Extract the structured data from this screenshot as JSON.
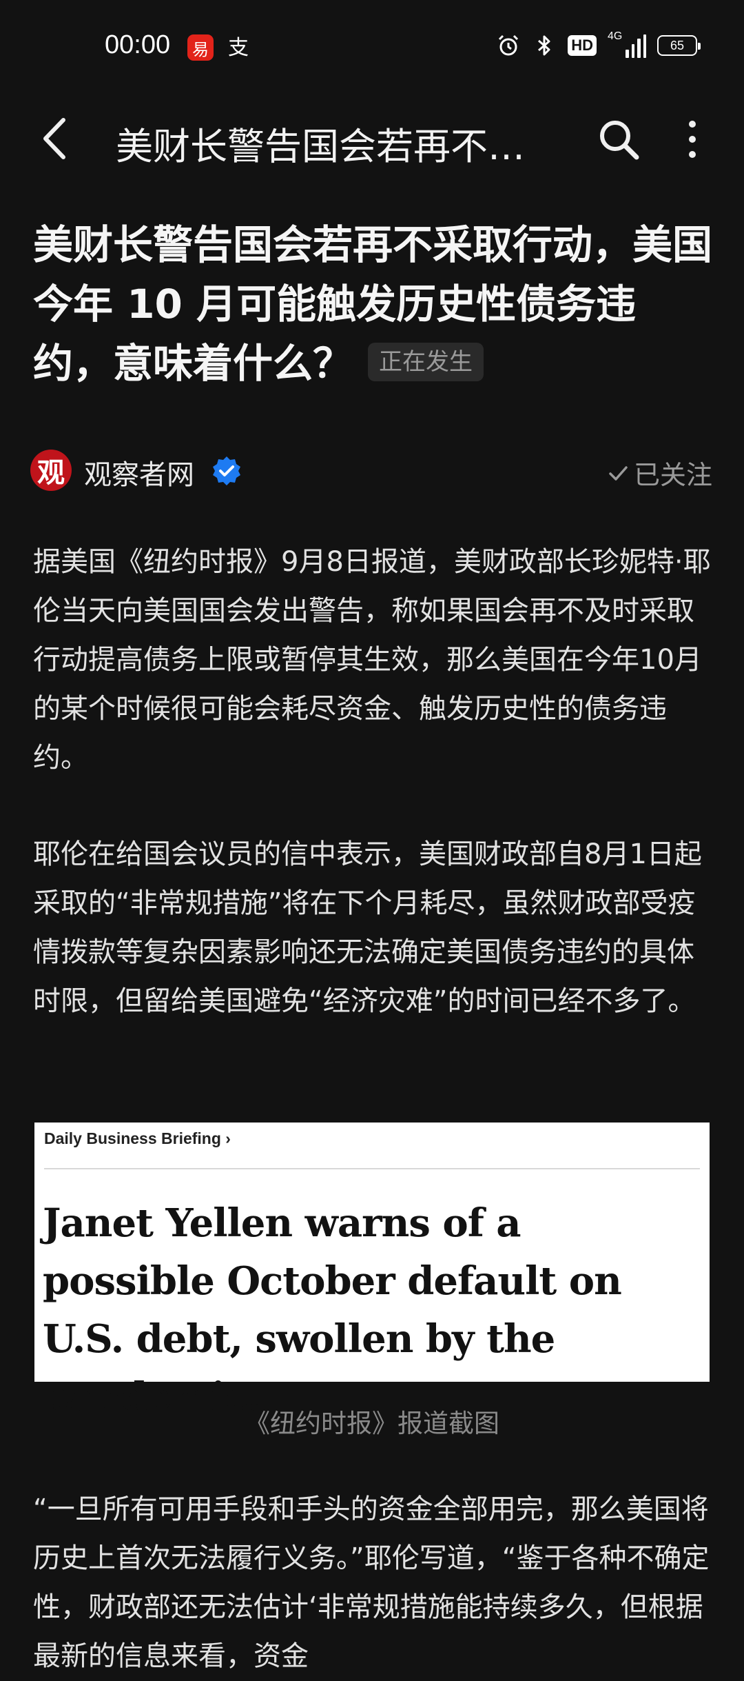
{
  "status_bar": {
    "time": "00:00",
    "app_badge": "易",
    "pay_glyph": "支",
    "hd": "HD",
    "network": "4G",
    "battery": "65"
  },
  "nav": {
    "title": "美财长警告国会若再不…"
  },
  "article": {
    "headline": "美财长警告国会若再不采取行动，美国今年 10 月可能触发历史性债务违约，意味着什么？",
    "live_tag": "正在发生",
    "author": {
      "avatar_char": "观",
      "name": "观察者网",
      "follow_label": "已关注"
    },
    "paragraphs": [
      "据美国《纽约时报》9月8日报道，美财政部长珍妮特·耶伦当天向美国国会发出警告，称如果国会再不及时采取行动提高债务上限或暂停其生效，那么美国在今年10月的某个时候很可能会耗尽资金、触发历史性的债务违约。",
      "耶伦在给国会议员的信中表示，美国财政部自8月1日起采取的“非常规措施”将在下个月耗尽，虽然财政部受疫情拨款等复杂因素影响还无法确定美国债务违约的具体时限，但留给美国避免“经济灾难”的时间已经不多了。",
      "“一旦所有可用手段和手头的资金全部用完，那么美国将历史上首次无法履行义务。”耶伦写道，“鉴于各种不确定性，财政部还无法估计‘非常规措施能持续多久，但根据最新的信息来看，资金"
    ],
    "image": {
      "kicker": "Daily Business Briefing",
      "headline": "Janet Yellen warns of a possible October default on U.S. debt, swollen by the pandemic."
    },
    "caption": "《纽约时报》报道截图"
  },
  "colors": {
    "background": "#121212",
    "verified_blue": "#1e7bf2",
    "badge_red": "#e2231a"
  }
}
